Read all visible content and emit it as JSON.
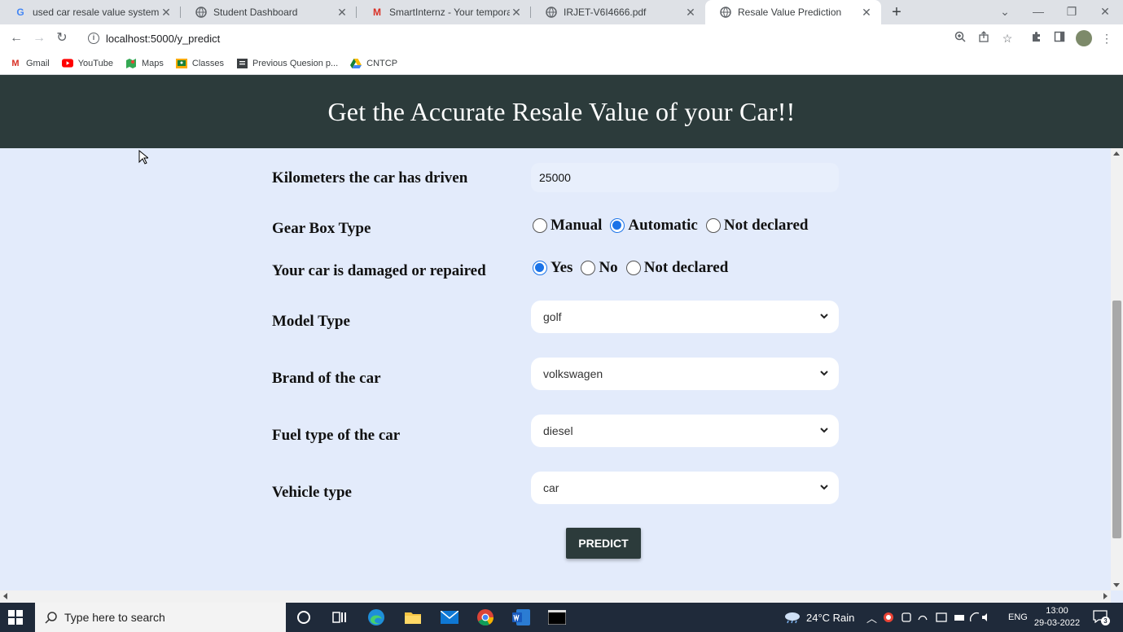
{
  "browser": {
    "tabs": [
      {
        "title": "used car resale value system - Go",
        "icon": "google-icon",
        "active": false
      },
      {
        "title": "Student Dashboard",
        "icon": "globe-icon",
        "active": false
      },
      {
        "title": "SmartInternz - Your temporary p",
        "icon": "gmail-icon",
        "active": false
      },
      {
        "title": "IRJET-V6I4666.pdf",
        "icon": "globe-icon",
        "active": false
      },
      {
        "title": "Resale Value Prediction",
        "icon": "globe-icon",
        "active": true
      }
    ],
    "url": "localhost:5000/y_predict",
    "bookmarks": [
      {
        "label": "Gmail",
        "icon": "gmail-icon"
      },
      {
        "label": "YouTube",
        "icon": "youtube-icon"
      },
      {
        "label": "Maps",
        "icon": "maps-icon"
      },
      {
        "label": "Classes",
        "icon": "classroom-icon"
      },
      {
        "label": "Previous Quesion p...",
        "icon": "document-icon"
      },
      {
        "label": "CNTCP",
        "icon": "drive-icon"
      }
    ]
  },
  "page": {
    "heading": "Get the Accurate Resale Value of your Car!!",
    "kilometers": {
      "label": "Kilometers the car has driven",
      "value": "25000"
    },
    "gearbox": {
      "label": "Gear Box Type",
      "options": [
        "Manual",
        "Automatic",
        "Not declared"
      ],
      "selected": "Automatic"
    },
    "damage": {
      "label": "Your car is damaged or repaired",
      "options": [
        "Yes",
        "No",
        "Not declared"
      ],
      "selected": "Yes"
    },
    "model": {
      "label": "Model Type",
      "value": "golf"
    },
    "brand": {
      "label": "Brand of the car",
      "value": "volkswagen"
    },
    "fuel": {
      "label": "Fuel type of the car",
      "value": "diesel"
    },
    "vehicle": {
      "label": "Vehicle type",
      "value": "car"
    },
    "predict_label": "PREDICT"
  },
  "taskbar": {
    "search_placeholder": "Type here to search",
    "weather": "24°C Rain",
    "language": "ENG",
    "time": "13:00",
    "date": "29-03-2022",
    "notifications": "3"
  },
  "colors": {
    "header_bg": "#2c3b3b",
    "page_bg": "#e3ebfb",
    "radio_accent": "#1a73e8"
  }
}
